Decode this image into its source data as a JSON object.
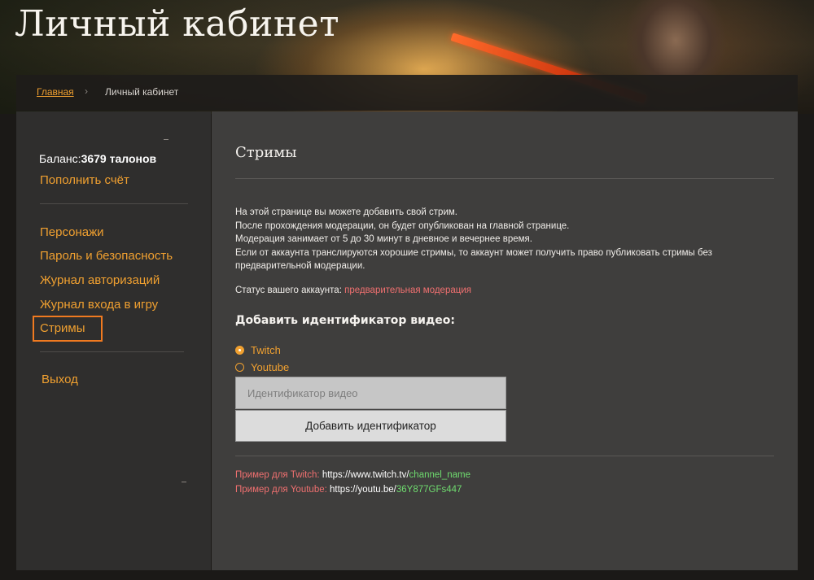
{
  "header": {
    "title": "Личный кабинет"
  },
  "breadcrumb": {
    "home": "Главная",
    "separator": "›",
    "current": "Личный кабинет"
  },
  "sidebar": {
    "balance_label": "Баланс:",
    "balance_value": "3679 талонов",
    "topup": "Пополнить счёт",
    "items": [
      {
        "label": "Персонажи"
      },
      {
        "label": "Пароль и безопасность"
      },
      {
        "label": "Журнал авторизаций"
      },
      {
        "label": "Журнал входа в игру"
      },
      {
        "label": "Стримы",
        "active": true
      }
    ],
    "logout": "Выход"
  },
  "main": {
    "title": "Стримы",
    "description": [
      "На этой странице вы можете добавить свой стрим.",
      "После прохождения модерации, он будет опубликован на главной странице.",
      "Модерация занимает от 5 до 30 минут в дневное и вечернее время.",
      "Если от аккаунта транслируются хорошие стримы, то аккаунт может получить право публиковать стримы без",
      "предварительной модерации."
    ],
    "status_label": "Статус вашего аккаунта:",
    "status_value": "предварительная модерация",
    "add_heading": "Добавить идентификатор видео:",
    "platforms": [
      {
        "label": "Twitch",
        "selected": true
      },
      {
        "label": "Youtube",
        "selected": false
      }
    ],
    "input_placeholder": "Идентификатор видео",
    "input_value": "",
    "submit_label": "Добавить идентификатор",
    "examples": [
      {
        "label": "Пример для Twitch:",
        "url": "https://www.twitch.tv/",
        "id": "channel_name"
      },
      {
        "label": "Пример для Youtube:",
        "url": "https://youtu.be/",
        "id": "36Y877GFs447"
      }
    ]
  },
  "colors": {
    "accent": "#f0a030",
    "active_border": "#f07a20",
    "status": "#f07070",
    "example_id": "#6fdc6f"
  }
}
